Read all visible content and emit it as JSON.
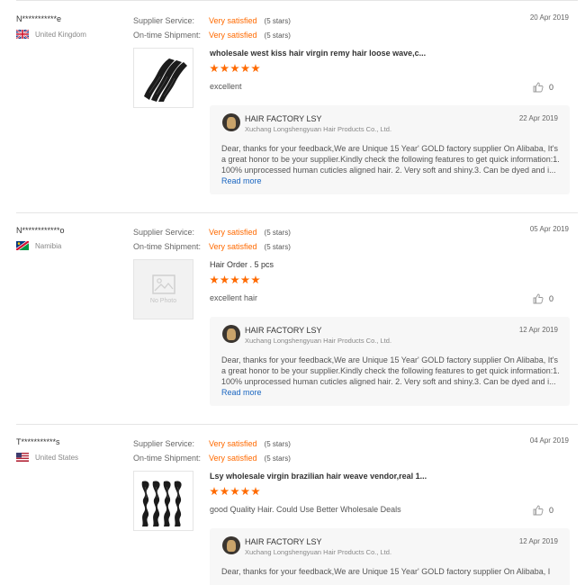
{
  "labels": {
    "supplier_service": "Supplier Service:",
    "ontime_shipment": "On-time Shipment:",
    "read_more": "Read more",
    "no_photo": "No Photo"
  },
  "reviews": [
    {
      "buyer": "N***********e",
      "country": "United Kingdom",
      "flag": "uk-flag",
      "supplier_service": {
        "value": "Very satisfied",
        "stars": "(5 stars)"
      },
      "shipment": {
        "value": "Very satisfied",
        "stars": "(5 stars)"
      },
      "date": "20 Apr 2019",
      "product_title": "wholesale west kiss hair virgin remy hair loose wave,c...",
      "rating": 5,
      "text": "excellent",
      "helpful": "0",
      "reply": {
        "name": "HAIR FACTORY LSY",
        "company": "Xuchang Longshengyuan Hair Products Co., Ltd.",
        "date": "22 Apr 2019",
        "text": "Dear, thanks for your feedback,We are Unique 15 Year' GOLD factory supplier On Alibaba, It's a great honor to be your supplier.Kindly check the following features to get quick information:1. 100% unprocessed human cuticles aligned hair. 2. Very soft and shiny.3. Can be dyed and i..."
      }
    },
    {
      "buyer": "N************o",
      "country": "Namibia",
      "flag": "namibia-flag",
      "supplier_service": {
        "value": "Very satisfied",
        "stars": "(5 stars)"
      },
      "shipment": {
        "value": "Very satisfied",
        "stars": "(5 stars)"
      },
      "date": "05 Apr 2019",
      "product_title": "Hair Order . 5 pcs",
      "rating": 5,
      "text": "excellent hair",
      "helpful": "0",
      "reply": {
        "name": "HAIR FACTORY LSY",
        "company": "Xuchang Longshengyuan Hair Products Co., Ltd.",
        "date": "12 Apr 2019",
        "text": "Dear, thanks for your feedback,We are Unique 15 Year' GOLD factory supplier On Alibaba, It's a great honor to be your supplier.Kindly check the following features to get quick information:1. 100% unprocessed human cuticles aligned hair. 2. Very soft and shiny.3. Can be dyed and i..."
      }
    },
    {
      "buyer": "T***********s",
      "country": "United States",
      "flag": "us-flag",
      "supplier_service": {
        "value": "Very satisfied",
        "stars": "(5 stars)"
      },
      "shipment": {
        "value": "Very satisfied",
        "stars": "(5 stars)"
      },
      "date": "04 Apr 2019",
      "product_title": "Lsy wholesale virgin brazilian hair weave vendor,real 1...",
      "rating": 5,
      "text": "good Quality Hair. Could Use Better Wholesale Deals",
      "helpful": "0",
      "reply": {
        "name": "HAIR FACTORY LSY",
        "company": "Xuchang Longshengyuan Hair Products Co., Ltd.",
        "date": "12 Apr 2019",
        "text": "Dear, thanks for your feedback,We are Unique 15 Year' GOLD factory supplier On Alibaba, I"
      }
    }
  ],
  "colors": {
    "accent": "#ff6a00",
    "link": "#1a66c1",
    "reply_bg": "#f7f7f7"
  }
}
